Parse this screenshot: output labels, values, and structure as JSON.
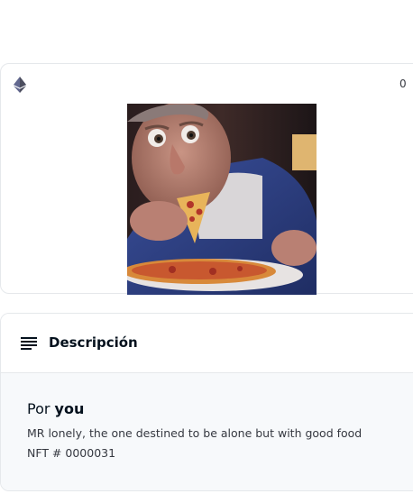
{
  "item_card": {
    "chain_icon": "ethereum-icon",
    "favorites_count": "0",
    "image_alt": "Old man eating pizza artwork"
  },
  "description": {
    "icon": "subject-lines-icon",
    "title": "Descripción",
    "by_prefix": "Por",
    "creator": "you",
    "text": "MR lonely, the one destined to be alone but with good food",
    "nft_number": "NFT # 0000031"
  }
}
